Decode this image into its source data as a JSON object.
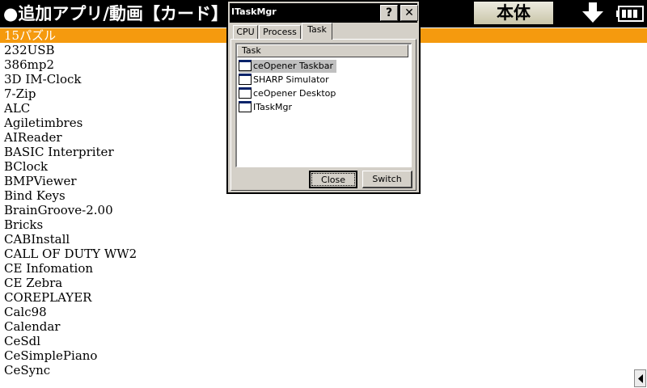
{
  "header": {
    "title": "●追加アプリ/動画【カード】",
    "main_button_label": "本体",
    "icons": {
      "download": "down-arrow-icon",
      "battery": "battery-icon"
    }
  },
  "app_list": {
    "selected_index": 0,
    "items": [
      "15パズル",
      "232USB",
      "386mp2",
      "3D IM-Clock",
      "7-Zip",
      "ALC",
      "Agiletimbres",
      "AIReader",
      "BASIC Interpriter",
      "BClock",
      "BMPViewer",
      "Bind Keys",
      "BrainGroove-2.00",
      "Bricks",
      "CABInstall",
      "CALL OF DUTY WW2",
      "CE Infomation",
      "CE Zebra",
      "COREPLAYER",
      "Calc98",
      "Calendar",
      "CeSdl",
      "CeSimplePiano",
      "CeSync"
    ]
  },
  "dialog": {
    "title": "ITaskMgr",
    "help_label": "?",
    "close_label": "✕",
    "tabs": [
      {
        "label": "CPU",
        "active": false
      },
      {
        "label": "Process",
        "active": false
      },
      {
        "label": "Task",
        "active": true
      }
    ],
    "list_header": "Task",
    "tasks": [
      {
        "label": "ceOpener Taskbar",
        "selected": true
      },
      {
        "label": "SHARP Simulator",
        "selected": false
      },
      {
        "label": "ceOpener Desktop",
        "selected": false
      },
      {
        "label": "ITaskMgr",
        "selected": false
      }
    ],
    "buttons": {
      "close": "Close",
      "switch": "Switch"
    }
  },
  "colors": {
    "header_bg": "#000000",
    "selection": "#f59a0e",
    "dialog_face": "#d4d0c8"
  }
}
